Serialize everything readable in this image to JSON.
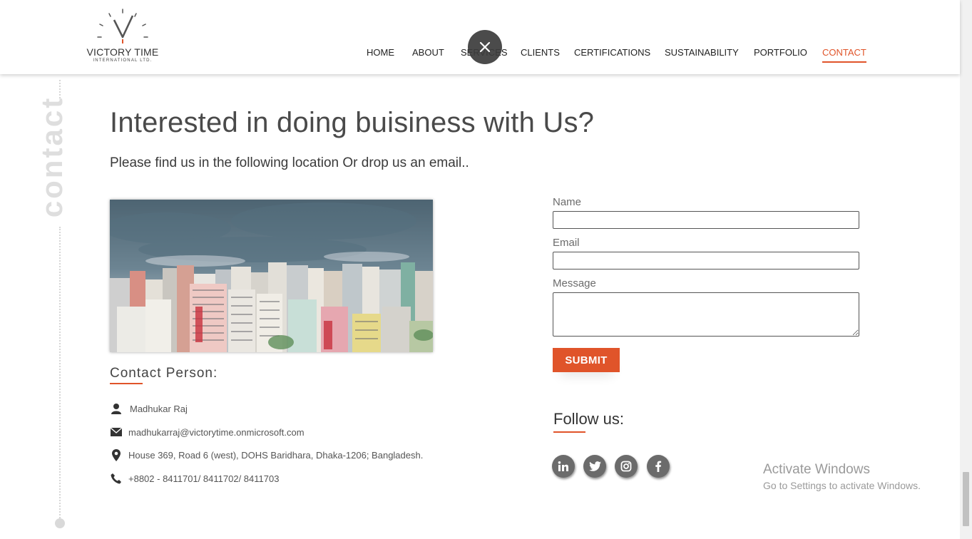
{
  "brand": {
    "name": "VICTORY TIME",
    "sub": "INTERNATIONAL LTD."
  },
  "nav": {
    "items": [
      {
        "label": "HOME"
      },
      {
        "label": "ABOUT"
      },
      {
        "label": "SERVICES"
      },
      {
        "label": "CLIENTS"
      },
      {
        "label": "CERTIFICATIONS"
      },
      {
        "label": "SUSTAINABILITY"
      },
      {
        "label": "PORTFOLIO"
      },
      {
        "label": "CONTACT",
        "active": true
      }
    ]
  },
  "side_label": "contact",
  "main": {
    "heading": "Interested in doing buisiness with Us?",
    "subheading": "Please find us in the following location Or drop us an email.."
  },
  "contact": {
    "title": "Contact Person:",
    "name": "Madhukar Raj",
    "email": "madhukarraj@victorytime.onmicrosoft.com",
    "address": "House 369, Road 6 (west), DOHS Baridhara, Dhaka-1206; Bangladesh.",
    "phone": "+8802 - 8411701/ 8411702/ 8411703"
  },
  "form": {
    "name_label": "Name",
    "name_value": "",
    "email_label": "Email",
    "email_value": "",
    "message_label": "Message",
    "message_value": "",
    "submit_label": "SUBMIT"
  },
  "follow": {
    "title": "Follow us:",
    "icons": [
      "linkedin-icon",
      "twitter-icon",
      "instagram-icon",
      "facebook-icon"
    ]
  },
  "windows_watermark": {
    "line1": "Activate Windows",
    "line2": "Go to Settings to activate Windows."
  },
  "colors": {
    "accent": "#e0542a",
    "nav_active": "#e0542a",
    "social_bg": "#6b6b6b"
  }
}
